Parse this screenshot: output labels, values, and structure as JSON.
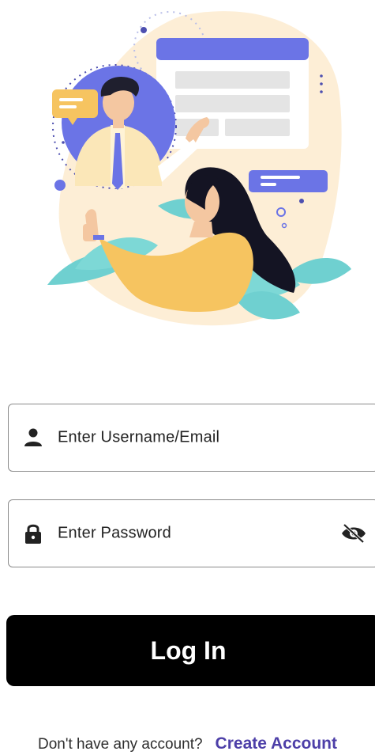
{
  "illustration": {
    "name": "login-illustration"
  },
  "form": {
    "username_placeholder": "Enter Username/Email",
    "password_placeholder": "Enter Password",
    "login_label": "Log In"
  },
  "footer": {
    "prompt": "Don't have any account?",
    "create_account_label": "Create Account"
  },
  "colors": {
    "accent": "#4d3fa8",
    "button_bg": "#000000",
    "illustration_blue": "#6b74e6",
    "illustration_peach": "#fdeed6",
    "illustration_teal": "#6fd0d0",
    "illustration_yellow": "#f6c460"
  },
  "icons": [
    "person-icon",
    "lock-icon",
    "eye-slash-icon"
  ]
}
